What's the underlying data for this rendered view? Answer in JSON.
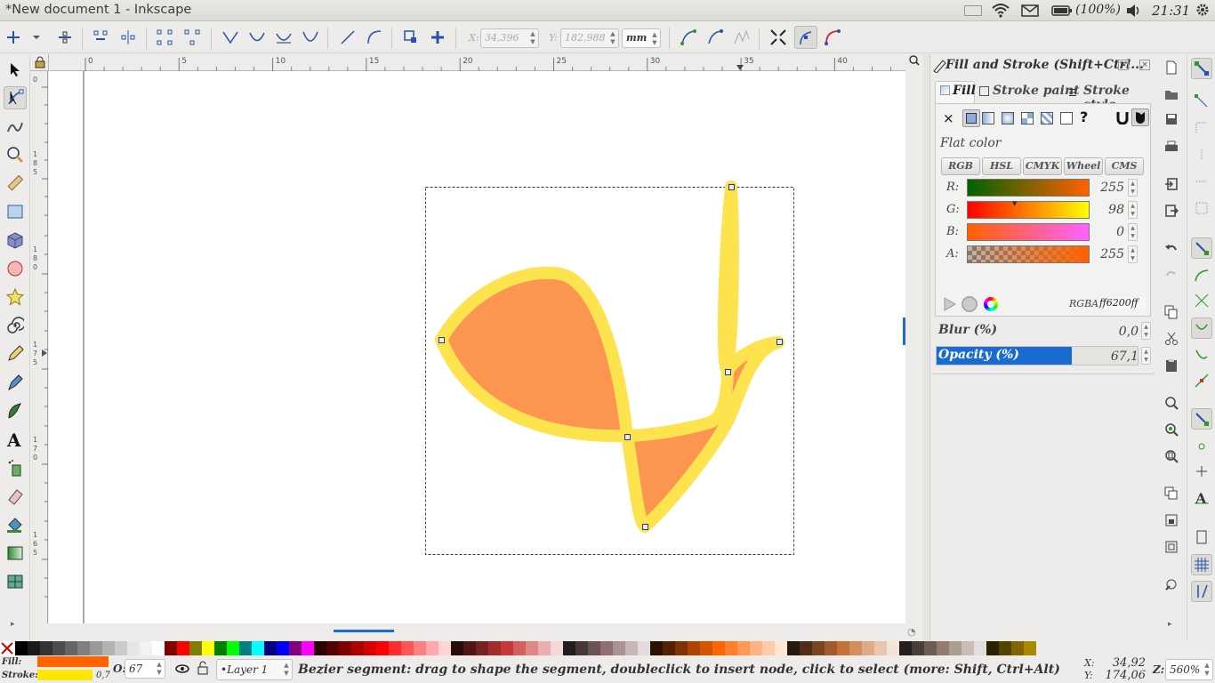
{
  "window": {
    "title": "*New document 1 - Inkscape"
  },
  "tray": {
    "battery": "(100%)",
    "clock": "21:31"
  },
  "toolbar": {
    "x_label": "X:",
    "x_value": "34,396",
    "y_label": "Y:",
    "y_value": "182,988",
    "unit": "mm"
  },
  "ruler": {
    "h_ticks": [
      "0",
      "5",
      "10",
      "15",
      "20",
      "25",
      "30",
      "35",
      "40"
    ]
  },
  "panel": {
    "title": "Fill and Stroke (Shift+Ctrl...",
    "tabs": [
      "Fill",
      "Stroke paint",
      "Stroke style"
    ],
    "paint_mode": "Flat color",
    "color_modes": [
      "RGB",
      "HSL",
      "CMYK",
      "Wheel",
      "CMS"
    ],
    "channels": [
      {
        "label": "R:",
        "value": "255"
      },
      {
        "label": "G:",
        "value": "98"
      },
      {
        "label": "B:",
        "value": "0"
      },
      {
        "label": "A:",
        "value": "255"
      }
    ],
    "rgba_label": "RGBA:",
    "rgba_value": "ff6200ff",
    "blur_label": "Blur (%)",
    "blur_value": "0,0",
    "opacity_label": "Opacity (%)",
    "opacity_value": "67,1",
    "opacity_fraction": 0.671
  },
  "status": {
    "fill_label": "Fill:",
    "stroke_label": "Stroke:",
    "stroke_width": "0,7",
    "opacity_label": "O:",
    "opacity_value": "67",
    "layer": "•Layer 1",
    "message": "Bezier segment: drag to shape the segment, doubleclick to insert node, click to select (more: Shift, Ctrl+Alt)",
    "cursor_x_label": "X:",
    "cursor_x": "34,92",
    "cursor_y_label": "Y:",
    "cursor_y": "174,06",
    "zoom_label": "Z:",
    "zoom": "560%"
  },
  "colors": {
    "fill": "#ff6200",
    "stroke": "#ffe600",
    "shape_fill_rendered": "#fc9550",
    "shape_stroke_rendered": "#fde44f",
    "accent": "#1a6bd0"
  },
  "palette": [
    "#000000",
    "#1a1a1a",
    "#333333",
    "#4d4d4d",
    "#666666",
    "#808080",
    "#999999",
    "#b3b3b3",
    "#cccccc",
    "#e6e6e6",
    "#f2f2f2",
    "#ffffff",
    "#800000",
    "#ff0000",
    "#808000",
    "#ffff00",
    "#008000",
    "#00ff00",
    "#008080",
    "#00ffff",
    "#000080",
    "#0000ff",
    "#800080",
    "#ff00ff",
    "#2b0000",
    "#550000",
    "#800000",
    "#aa0000",
    "#d40000",
    "#ff0000",
    "#ff2a2a",
    "#ff5555",
    "#ff8080",
    "#ffaaaa",
    "#ffd5d5",
    "#280b0b",
    "#501616",
    "#782121",
    "#a02c2c",
    "#c83737",
    "#d35f5f",
    "#de8787",
    "#e9afaf",
    "#f4d7d7",
    "#241c1c",
    "#483737",
    "#6c5353",
    "#916f6f",
    "#ac9393",
    "#c8b7b7",
    "#e3dbdb",
    "#2b1100",
    "#552200",
    "#803300",
    "#aa4400",
    "#d45500",
    "#ff6600",
    "#ff7f2a",
    "#ff9955",
    "#ffb380",
    "#ffccaa",
    "#ffe6d5",
    "#28170b",
    "#502d16",
    "#784421",
    "#a05a2c",
    "#c87137",
    "#d38d5f",
    "#deaa87",
    "#e9c6af",
    "#f4e3d7",
    "#241f1c",
    "#483e37",
    "#6c5d53",
    "#917c6f",
    "#ac9d93",
    "#c8beb7",
    "#e3dedb",
    "#2b2200",
    "#554400",
    "#806600",
    "#aa8800"
  ],
  "icons": {
    "tools": [
      "selector-icon",
      "node-editor-icon",
      "tweak-icon",
      "zoom-icon",
      "measure-icon",
      "rectangle-icon",
      "3d-box-icon",
      "ellipse-icon",
      "star-icon",
      "spiral-icon",
      "pencil-icon",
      "pen-icon",
      "calligraphy-icon",
      "text-icon",
      "spray-icon",
      "eraser-icon",
      "paint-bucket-icon",
      "gradient-icon",
      "mesh-icon"
    ]
  }
}
